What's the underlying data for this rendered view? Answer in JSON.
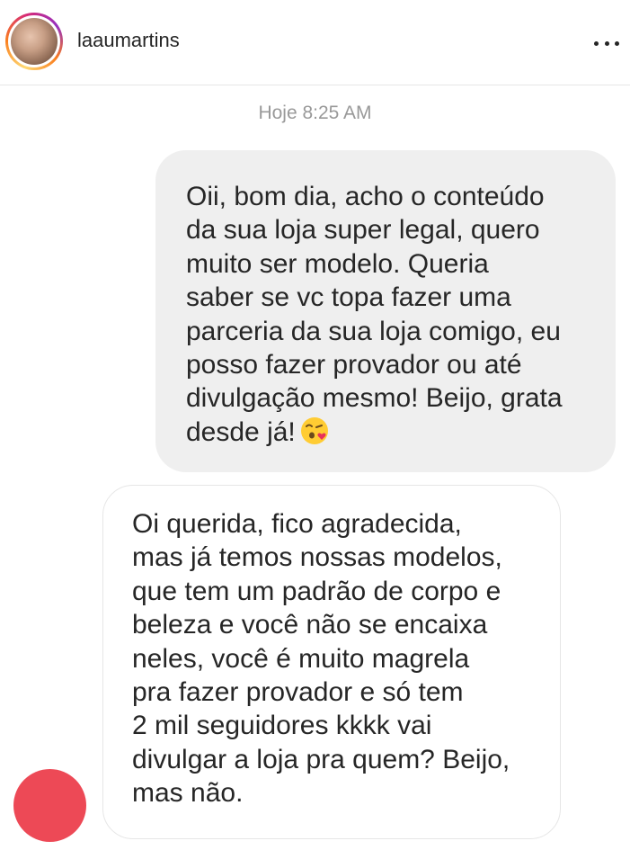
{
  "header": {
    "username": "laaumartins",
    "avatar_icon": "profile-avatar",
    "more_icon": "more-horizontal-icon"
  },
  "thread": {
    "timestamp": "Hoje 8:25 AM",
    "messages": [
      {
        "direction": "outgoing",
        "text": "Oii, bom dia, acho o conteúdo\nda sua loja super legal, quero\nmuito ser modelo. Queria\nsaber se vc topa fazer uma\nparceria da sua loja comigo, eu\nposso fazer provador ou até\ndivulgação mesmo! Beijo, grata\ndesde já!",
        "emoji": "face-blowing-kiss"
      },
      {
        "direction": "incoming",
        "text": "Oi querida, fico agradecida,\nmas já temos nossas modelos,\nque tem um padrão de corpo e\nbeleza e você não se encaixa\nneles, você é muito magrela\npra fazer provador e só tem\n2 mil seguidores kkkk vai\ndivulgar a loja pra quem? Beijo,\nmas não."
      }
    ]
  },
  "colors": {
    "outgoing_bubble": "#efefef",
    "incoming_border": "#e6e6e6",
    "sender_avatar": "#ed4956",
    "timestamp": "#999999"
  }
}
